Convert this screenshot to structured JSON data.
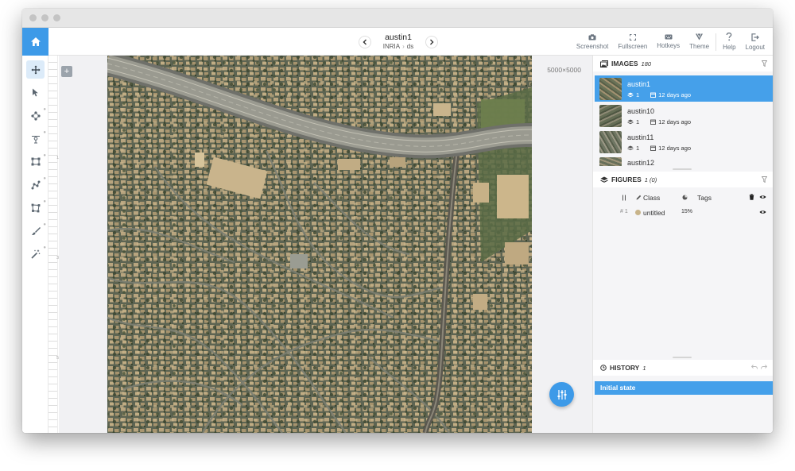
{
  "topbar": {
    "image_title": "austin1",
    "breadcrumb": [
      "INRIA",
      "ds"
    ],
    "tools": [
      {
        "label": "Screenshot",
        "icon": "camera-icon"
      },
      {
        "label": "Fullscreen",
        "icon": "fullscreen-icon"
      },
      {
        "label": "Hotkeys",
        "icon": "keyboard-icon"
      },
      {
        "label": "Theme",
        "icon": "theme-icon"
      },
      {
        "label": "Help",
        "icon": "help-icon"
      },
      {
        "label": "Logout",
        "icon": "logout-icon"
      }
    ]
  },
  "left_tools": [
    "move-tool-icon",
    "pointer-tool-icon",
    "points-tool-icon",
    "point-tool-icon",
    "rectangle-tool-icon",
    "polyline-tool-icon",
    "polygon-tool-icon",
    "brush-tool-icon",
    "magic-wand-tool-icon"
  ],
  "ruler": {
    "labels": [
      "182",
      "364",
      "546"
    ]
  },
  "canvas": {
    "dimensions": "5000×5000",
    "add_label": "+"
  },
  "images": {
    "title": "IMAGES",
    "count": "180",
    "items": [
      {
        "name": "austin1",
        "layers": "1",
        "date": "12 days ago",
        "selected": true
      },
      {
        "name": "austin10",
        "layers": "1",
        "date": "12 days ago",
        "selected": false
      },
      {
        "name": "austin11",
        "layers": "1",
        "date": "12 days ago",
        "selected": false
      },
      {
        "name": "austin12",
        "layers": "",
        "date": "",
        "selected": false
      }
    ]
  },
  "figures": {
    "title": "FIGURES",
    "count": "1 (0)",
    "columns": {
      "class": "Class",
      "tags": "Tags"
    },
    "rows": [
      {
        "index": "# 1",
        "name": "untitled",
        "percent": "15%",
        "color": "#c8b48a"
      }
    ]
  },
  "history": {
    "title": "HISTORY",
    "count": "1",
    "items": [
      "Initial state"
    ]
  },
  "colors": {
    "accent": "#3d9ae8",
    "selected": "#45a0ea"
  }
}
